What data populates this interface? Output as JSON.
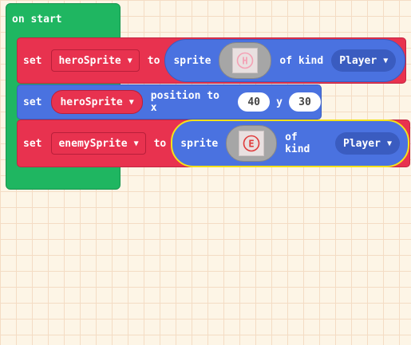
{
  "on_start_label": "on start",
  "blocks": [
    {
      "set_label": "set",
      "variable": "heroSprite",
      "to_label": "to",
      "sprite_label": "sprite",
      "sprite_glyph": "H",
      "of_kind_label": "of kind",
      "kind": "Player"
    },
    {
      "set_label": "set",
      "variable": "heroSprite",
      "position_label": "position to x",
      "x": "40",
      "y_label": "y",
      "y": "30"
    },
    {
      "set_label": "set",
      "variable": "enemySprite",
      "to_label": "to",
      "sprite_label": "sprite",
      "sprite_glyph": "E",
      "of_kind_label": "of kind",
      "kind": "Player"
    }
  ],
  "colors": {
    "events_green": "#1fb661",
    "sprites_red": "#e8324f",
    "sprites_blue": "#4a72e0",
    "selection_yellow": "#f5e11a",
    "hero_glyph": "#f4a0b4",
    "enemy_glyph": "#e03a3a"
  }
}
